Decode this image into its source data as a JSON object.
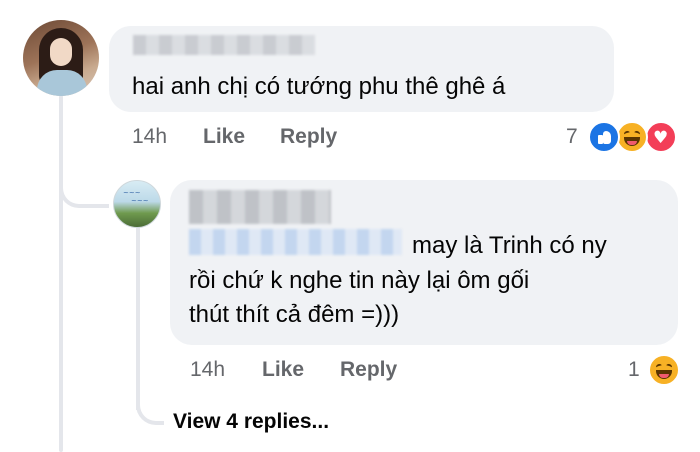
{
  "comment": {
    "text": "hai anh chị có tướng phu thê ghê á",
    "time": "14h",
    "like_label": "Like",
    "reply_label": "Reply",
    "reaction_count": "7",
    "reactions": [
      "like-icon",
      "haha-icon",
      "love-icon"
    ]
  },
  "reply": {
    "text_line1": "may là Trinh có ny",
    "text_line2": "rồi chứ k nghe tin này lại ôm gối",
    "text_line3": "thút thít cả đêm =)))",
    "time": "14h",
    "like_label": "Like",
    "reply_label": "Reply",
    "reaction_count": "1",
    "reactions": [
      "haha-icon"
    ]
  },
  "view_replies_label": "View 4 replies...",
  "colors": {
    "bubble": "#f0f2f5",
    "meta_text": "#65676b",
    "like_blue": "#1b74e4",
    "haha_yellow": "#f7b125",
    "love_red": "#f33e58"
  }
}
